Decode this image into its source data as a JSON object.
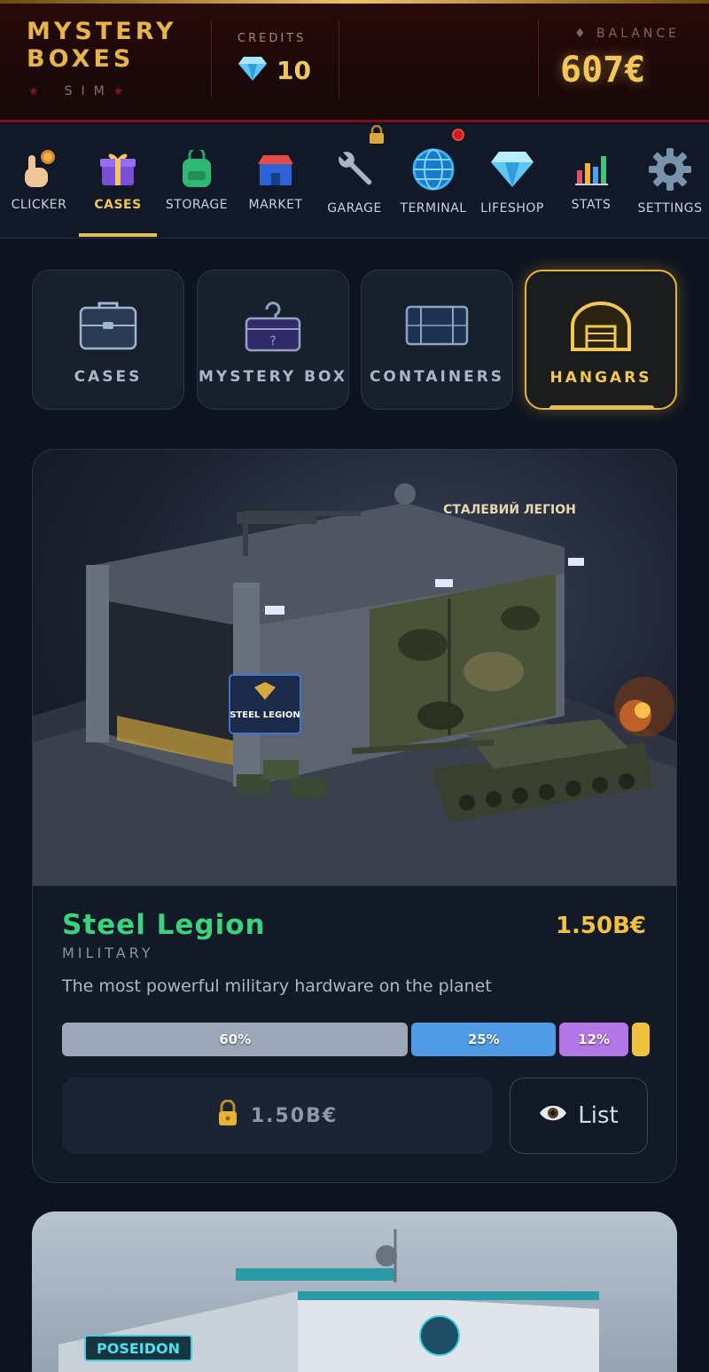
{
  "header": {
    "logo_line1": "MYSTERY",
    "logo_line2": "BOXES",
    "logo_sub": "SIM",
    "credits_label": "CREDITS",
    "credits_value": "10",
    "balance_label": "BALANCE",
    "balance_value": "607€"
  },
  "nav": {
    "items": [
      {
        "label": "CLICKER",
        "icon": "pointer-coin-icon"
      },
      {
        "label": "CASES",
        "icon": "gift-box-icon"
      },
      {
        "label": "STORAGE",
        "icon": "backpack-icon"
      },
      {
        "label": "MARKET",
        "icon": "store-icon"
      },
      {
        "label": "GARAGE",
        "icon": "wrench-icon"
      },
      {
        "label": "TERMINAL",
        "icon": "globe-icon"
      },
      {
        "label": "LIFESHOP",
        "icon": "diamond-icon"
      },
      {
        "label": "STATS",
        "icon": "bar-chart-icon"
      },
      {
        "label": "SETTINGS",
        "icon": "gear-icon"
      }
    ],
    "active": "CASES"
  },
  "categories": [
    {
      "label": "CASES",
      "icon": "briefcase-icon"
    },
    {
      "label": "MYSTERY BOX",
      "icon": "mystery-bag-icon"
    },
    {
      "label": "CONTAINERS",
      "icon": "container-icon"
    },
    {
      "label": "HANGARS",
      "icon": "hangar-icon"
    }
  ],
  "active_category": "HANGARS",
  "card": {
    "title": "Steel Legion",
    "price": "1.50B€",
    "category": "MILITARY",
    "description": "The most powerful military hardware on the planet",
    "sign_ua": "СТАЛЕВИЙ ЛЕГІОН",
    "sign_en": "STEEL LEGION",
    "odds": [
      {
        "label": "60%",
        "value": 60,
        "color": "#9ca7ba"
      },
      {
        "label": "25%",
        "value": 25,
        "color": "#4f9be6"
      },
      {
        "label": "12%",
        "value": 12,
        "color": "#b476e6"
      },
      {
        "label": "",
        "value": 3,
        "color": "#f0c13d"
      }
    ],
    "open_button": "1.50B€",
    "list_button": "List"
  },
  "card2": {
    "sign": "POSEIDON"
  },
  "colors": {
    "gold": "#f2c659",
    "green_title": "#3bd37c",
    "background": "#0d1320"
  }
}
